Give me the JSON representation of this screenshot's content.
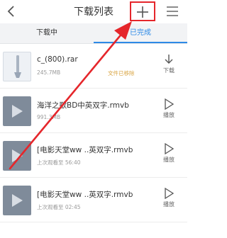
{
  "header": {
    "title": "下载列表",
    "back_icon": "chevron-left-icon",
    "add_icon": "plus-icon",
    "menu_icon": "hamburger-icon",
    "highlight_color": "#e5262b"
  },
  "tabs": [
    {
      "label": "下载中",
      "active": false
    },
    {
      "label": "已完成",
      "active": true
    }
  ],
  "accent_color": "#2e8ae6",
  "items": [
    {
      "name": "c_(800).rar",
      "sub": "245.7MB",
      "status": "文件已移除",
      "action": "下载",
      "thumb": "file-icon"
    },
    {
      "name": "海洋之歌BD中英双字.rmvb",
      "sub": "991.3MB",
      "status": "",
      "action": "播放",
      "thumb": "video-icon"
    },
    {
      "name": "[电影天堂ww ..英双字.rmvb",
      "sub": "上次观看至 56:40",
      "status": "",
      "action": "播放",
      "thumb": "video-icon"
    },
    {
      "name": "[电影天堂ww ..英双字.rmvb",
      "sub": "上次观看至 02:45",
      "status": "",
      "action": "播放",
      "thumb": "video-icon"
    }
  ]
}
